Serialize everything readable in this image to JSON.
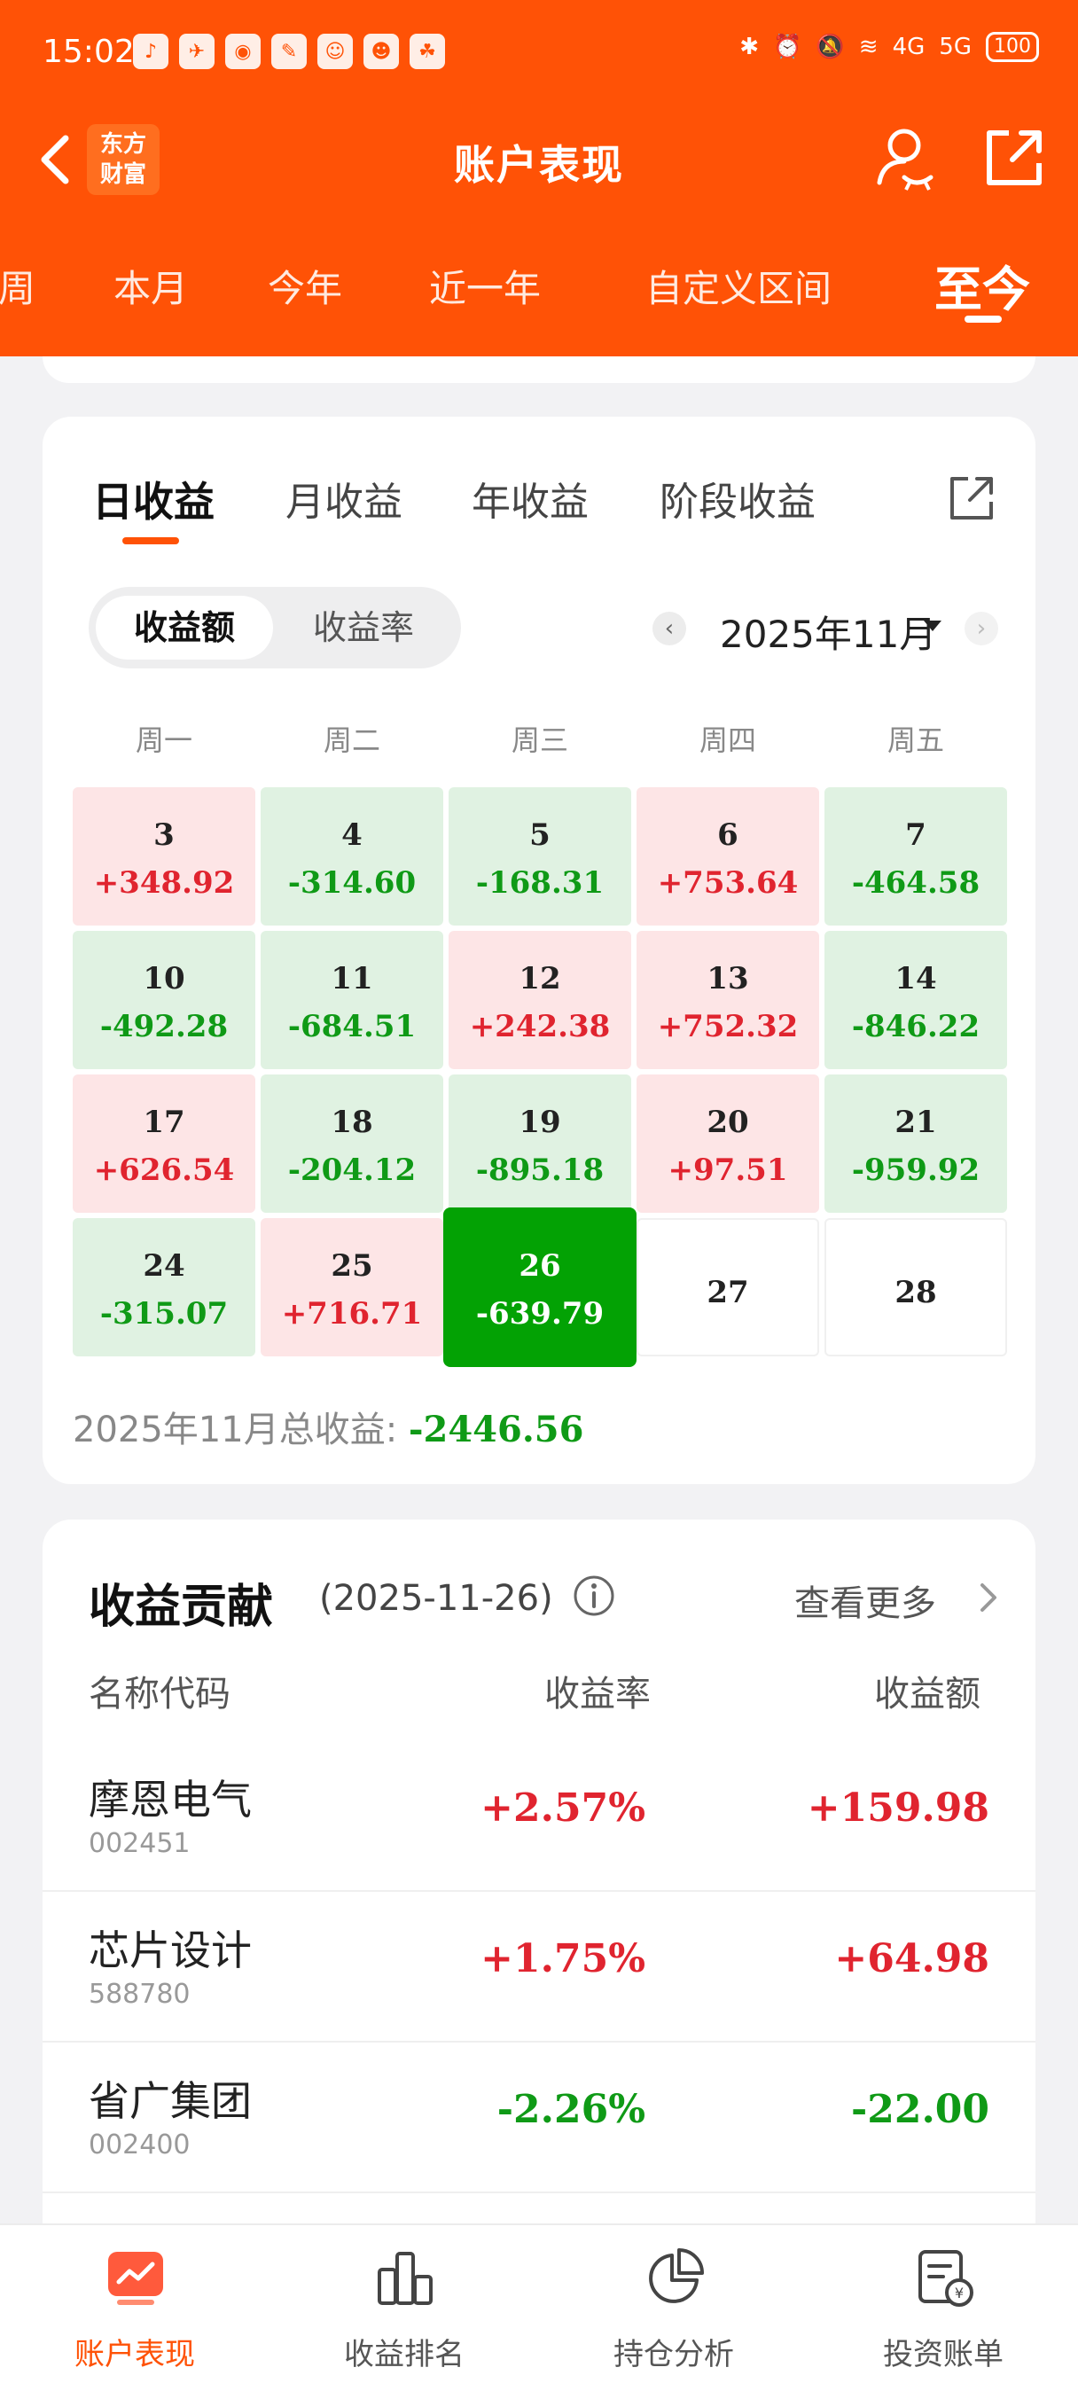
{
  "status_bar": {
    "time": "15:02",
    "battery": "100",
    "signal_4g": "4G",
    "signal_5g": "5G"
  },
  "header": {
    "title": "账户表现",
    "logo_line1": "东方",
    "logo_line2": "财富",
    "accent_color": "#ff5206"
  },
  "period_tabs": [
    "周",
    "本月",
    "今年",
    "近一年",
    "自定义区间",
    "至今"
  ],
  "period_active": "至今",
  "calendar_card": {
    "tabs": [
      "日收益",
      "月收益",
      "年收益",
      "阶段收益"
    ],
    "active_tab": "日收益",
    "segment": {
      "on": "收益额",
      "off": "收益率"
    },
    "month": "2025年11月",
    "weekdays": [
      "周一",
      "周二",
      "周三",
      "周四",
      "周五"
    ],
    "days": [
      {
        "day": "3",
        "amount": "+348.92",
        "kind": "pos"
      },
      {
        "day": "4",
        "amount": "-314.60",
        "kind": "neg"
      },
      {
        "day": "5",
        "amount": "-168.31",
        "kind": "neg"
      },
      {
        "day": "6",
        "amount": "+753.64",
        "kind": "pos"
      },
      {
        "day": "7",
        "amount": "-464.58",
        "kind": "neg"
      },
      {
        "day": "10",
        "amount": "-492.28",
        "kind": "neg"
      },
      {
        "day": "11",
        "amount": "-684.51",
        "kind": "neg"
      },
      {
        "day": "12",
        "amount": "+242.38",
        "kind": "pos"
      },
      {
        "day": "13",
        "amount": "+752.32",
        "kind": "pos"
      },
      {
        "day": "14",
        "amount": "-846.22",
        "kind": "neg"
      },
      {
        "day": "17",
        "amount": "+626.54",
        "kind": "pos"
      },
      {
        "day": "18",
        "amount": "-204.12",
        "kind": "neg"
      },
      {
        "day": "19",
        "amount": "-895.18",
        "kind": "neg"
      },
      {
        "day": "20",
        "amount": "+97.51",
        "kind": "pos"
      },
      {
        "day": "21",
        "amount": "-959.92",
        "kind": "neg"
      },
      {
        "day": "24",
        "amount": "-315.07",
        "kind": "neg"
      },
      {
        "day": "25",
        "amount": "+716.71",
        "kind": "pos"
      },
      {
        "day": "26",
        "amount": "-639.79",
        "kind": "sel"
      },
      {
        "day": "27",
        "amount": "",
        "kind": "blank"
      },
      {
        "day": "28",
        "amount": "",
        "kind": "blank"
      }
    ],
    "total_label": "2025年11月总收益: ",
    "total_value": "-2446.56",
    "colors": {
      "gain": "#e0242f",
      "loss": "#0f9a16",
      "selected": "#03a204"
    }
  },
  "contribution": {
    "title": "收益贡献",
    "date": "(2025-11-26)",
    "more": "查看更多",
    "columns": [
      "名称代码",
      "收益率",
      "收益额"
    ],
    "rows": [
      {
        "name": "摩恩电气",
        "code": "002451",
        "rate": "+2.57%",
        "amount": "+159.98",
        "dir": "red"
      },
      {
        "name": "芯片设计",
        "code": "588780",
        "rate": "+1.75%",
        "amount": "+64.98",
        "dir": "red"
      },
      {
        "name": "省广集团",
        "code": "002400",
        "rate": "-2.26%",
        "amount": "-22.00",
        "dir": "green"
      }
    ]
  },
  "bottom_nav": [
    {
      "label": "账户表现",
      "icon": "chart-line-icon",
      "active": true
    },
    {
      "label": "收益排名",
      "icon": "bar-chart-icon",
      "active": false
    },
    {
      "label": "持仓分析",
      "icon": "pie-chart-icon",
      "active": false
    },
    {
      "label": "投资账单",
      "icon": "bill-icon",
      "active": false
    }
  ]
}
